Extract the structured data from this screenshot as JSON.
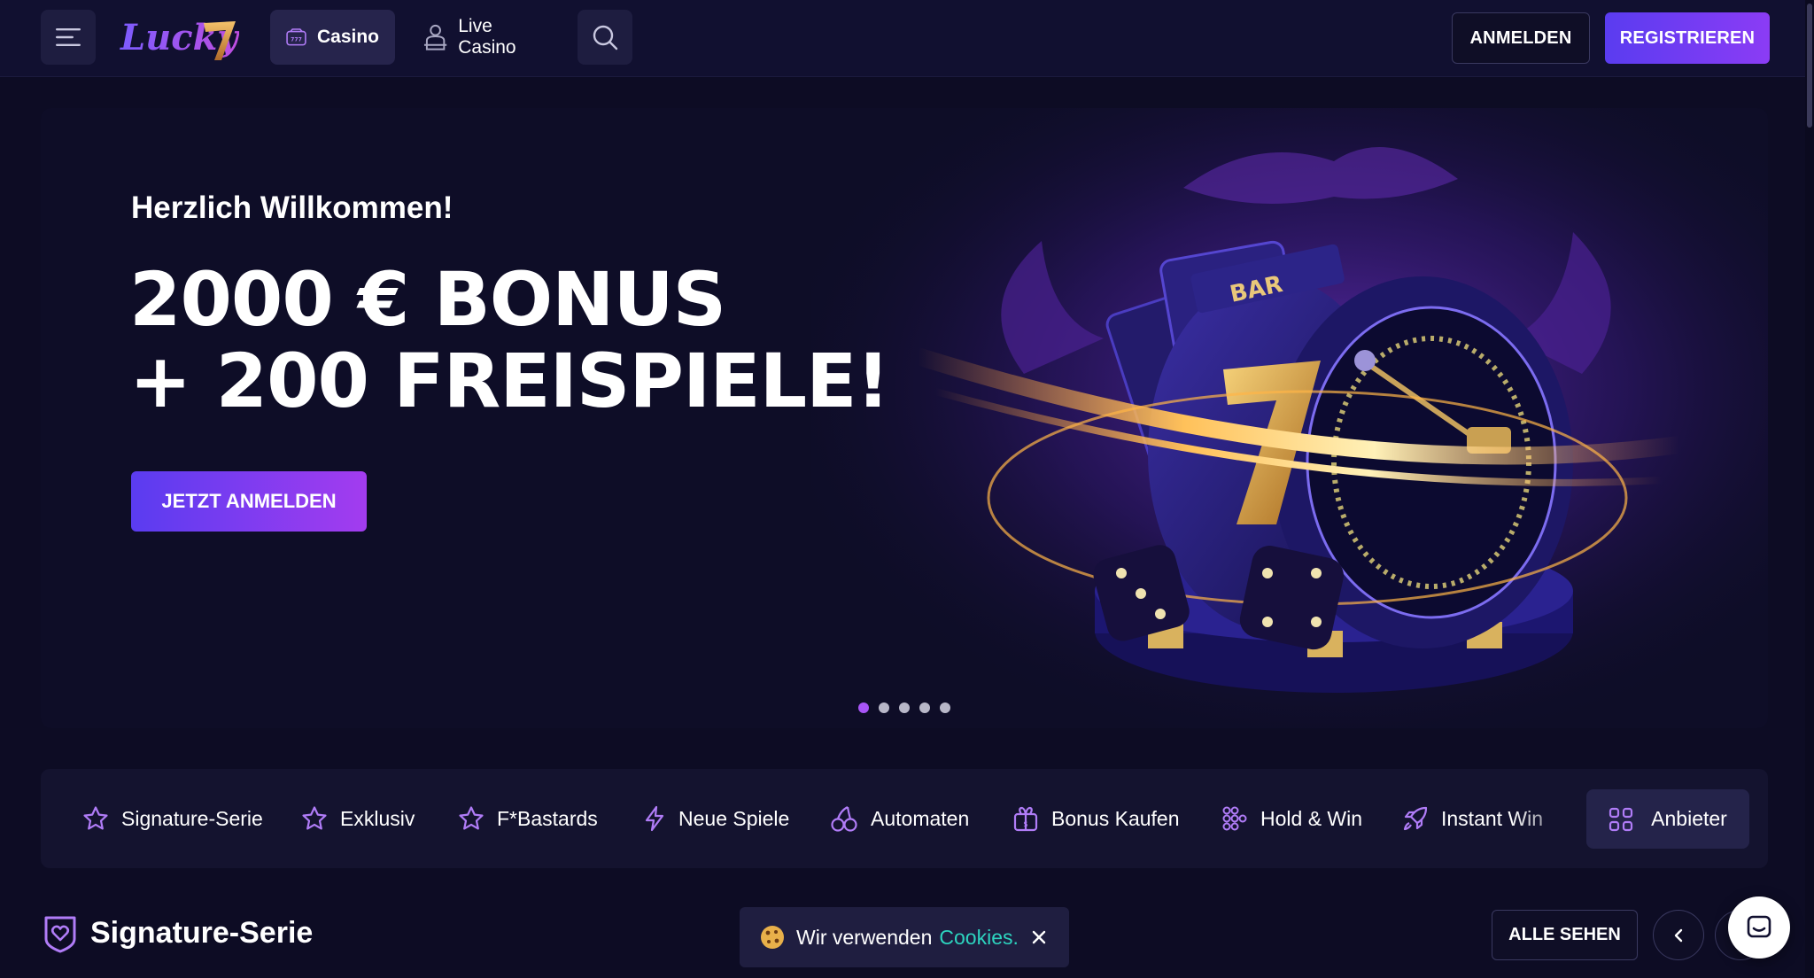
{
  "header": {
    "logo_text": "Lucky7",
    "nav": [
      {
        "label": "Casino",
        "icon": "slot-machine-icon",
        "active": true
      },
      {
        "label": "Live Casino",
        "icon": "dealer-icon",
        "active": false
      }
    ],
    "login_label": "ANMELDEN",
    "register_label": "REGISTRIEREN"
  },
  "hero": {
    "welcome": "Herzlich Willkommen!",
    "title_line1": "2000 € BONUS",
    "title_line2": "+ 200 FREISPIELE!",
    "cta_label": "JETZT ANMELDEN",
    "slides_total": 5,
    "slide_active": 1
  },
  "categories": {
    "items": [
      {
        "label": "Signature-Serie",
        "icon": "star-icon"
      },
      {
        "label": "Exklusiv",
        "icon": "star-icon"
      },
      {
        "label": "F*Bastards",
        "icon": "star-icon"
      },
      {
        "label": "Neue Spiele",
        "icon": "lightning-icon"
      },
      {
        "label": "Automaten",
        "icon": "cherry-icon"
      },
      {
        "label": "Bonus Kaufen",
        "icon": "gift-icon"
      },
      {
        "label": "Hold & Win",
        "icon": "dots-grid-icon"
      },
      {
        "label": "Instant Win",
        "icon": "rocket-icon"
      }
    ],
    "providers_label": "Anbieter"
  },
  "section": {
    "title": "Signature-Serie",
    "see_all_label": "ALLE SEHEN"
  },
  "cookie": {
    "text": "Wir verwenden",
    "link": "Cookies."
  },
  "colors": {
    "background": "#0d0c24",
    "accent_purple": "#a855f7",
    "button_gradient_start": "#5a3cf0",
    "cookie_link": "#2dd4bf"
  }
}
